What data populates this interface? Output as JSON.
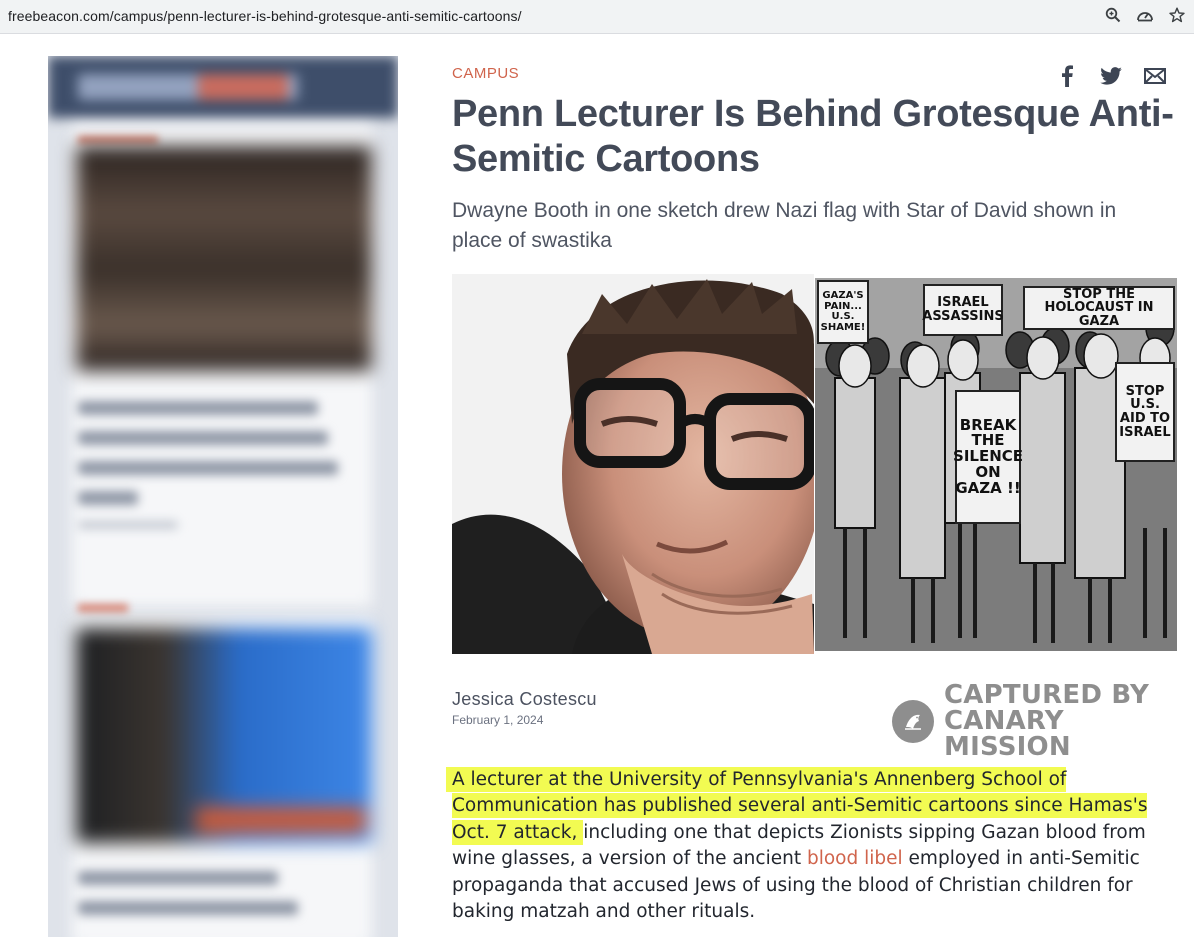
{
  "browser": {
    "url": "freebeacon.com/campus/penn-lecturer-is-behind-grotesque-anti-semitic-cartoons/",
    "icons": [
      "zoom-icon",
      "performance-icon",
      "bookmark-star-icon"
    ]
  },
  "article": {
    "category": "CAMPUS",
    "share_icons": [
      "facebook-icon",
      "twitter-icon",
      "email-icon"
    ],
    "title": "Penn Lecturer Is Behind Grotesque Anti-Semitic Cartoons",
    "subtitle": "Dwayne Booth in one sketch drew Nazi flag with Star of David shown in place of swastika",
    "image": {
      "signs": {
        "gazas_pain": "GAZA'S PAIN... U.S. SHAME!",
        "israel_assassins": "ISRAEL ASSASSINS",
        "stop_holocaust": "STOP THE HOLOCAUST IN GAZA",
        "break_silence": "BREAK THE SILENCE ON GAZA !!",
        "stop_aid": "STOP U.S. AID TO ISRAEL"
      }
    },
    "author": "Jessica Costescu",
    "date": "February 1, 2024",
    "credit": {
      "line1": "CAPTURED BY",
      "line2": "CANARY MISSION"
    },
    "body": {
      "highlighted": "A lecturer at the University of Pennsylvania's Annenberg School of Communication has published several anti-Semitic cartoons since Hamas's Oct. 7 attack,",
      "text1": " including one that depicts Zionists sipping Gazan blood from wine glasses, a version of the ancient ",
      "link": "blood libel",
      "text2": " employed in anti-Semitic propaganda that accused Jews of using the blood of Christian children for baking matzah and other rituals."
    }
  },
  "colors": {
    "accent": "#d0644c",
    "title": "#434a58",
    "highlight": "#f2fb52",
    "credit_gray": "#8e8e8e"
  }
}
